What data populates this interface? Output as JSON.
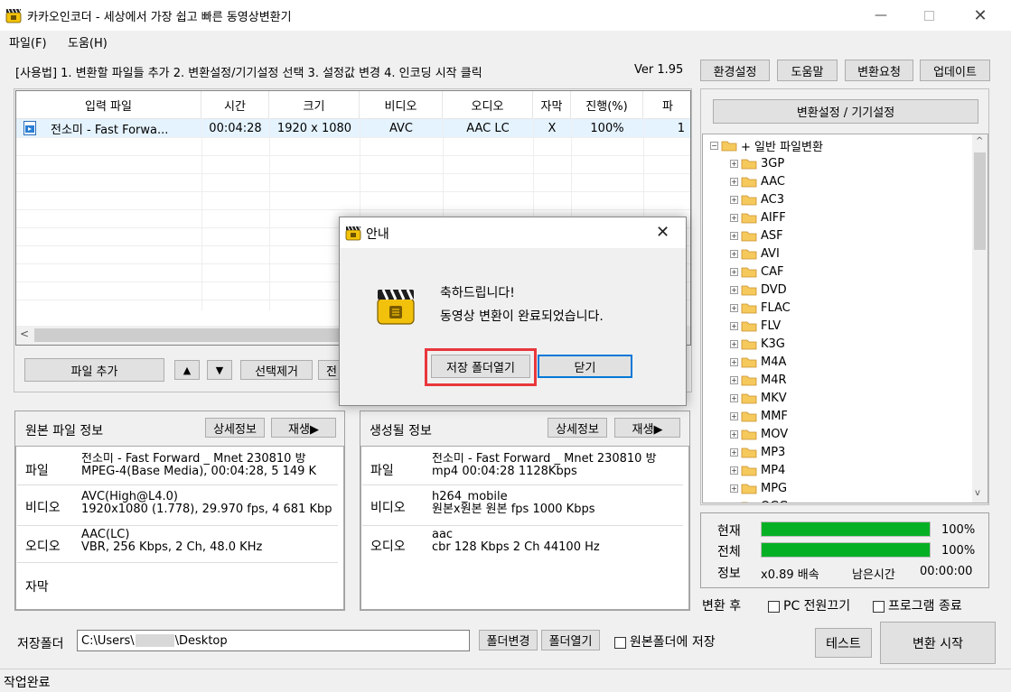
{
  "window": {
    "title": "카카오인코더 - 세상에서 가장 쉽고 빠른 동영상변환기"
  },
  "menu": [
    "파일(F)",
    "도움(H)"
  ],
  "usage_text": "[사용법] 1. 변환할 파일들 추가   2. 변환설정/기기설정 선택   3. 설정값 변경   4. 인코딩 시작 클릭",
  "version": "Ver 1.95",
  "top_buttons": [
    "환경설정",
    "도움말",
    "변환요청",
    "업데이트"
  ],
  "filelist": {
    "columns": [
      "입력 파일",
      "시간",
      "크기",
      "비디오",
      "오디오",
      "자막",
      "진행(%)",
      "파"
    ],
    "rows": [
      {
        "name": "전소미 - Fast Forwa...",
        "time": "00:04:28",
        "size": "1920 x 1080",
        "video": "AVC",
        "audio": "AAC LC",
        "subtitle": "X",
        "progress": "100%",
        "extra": "1"
      }
    ]
  },
  "list_buttons": {
    "add": "파일 추가",
    "up": "▲",
    "down": "▼",
    "remove": "선택제거",
    "clear": "전"
  },
  "source_info": {
    "title": "원본 파일 정보",
    "detail_btn": "상세정보",
    "play_btn": "재생▶",
    "file_label": "파일",
    "file_val1": "전소미 - Fast Forward _ Mnet 230810 방",
    "file_val2": "MPEG-4(Base Media), 00:04:28, 5 149 K",
    "video_label": "비디오",
    "video_val1": "AVC(High@L4.0)",
    "video_val2": "1920x1080 (1.778), 29.970 fps, 4 681 Kbp",
    "audio_label": "오디오",
    "audio_val1": "AAC(LC)",
    "audio_val2": "VBR, 256 Kbps, 2 Ch, 48.0 KHz",
    "sub_label": "자막"
  },
  "output_info": {
    "title": "생성될 정보",
    "detail_btn": "상세정보",
    "play_btn": "재생▶",
    "file_label": "파일",
    "file_val1": "전소미 - Fast Forward _ Mnet 230810 방",
    "file_val2": "mp4  00:04:28  1128Kbps",
    "video_label": "비디오",
    "video_val1": "h264_mobile",
    "video_val2": "원본x원본  원본 fps   1000 Kbps",
    "audio_label": "오디오",
    "audio_val1": "aac",
    "audio_val2": "cbr     128 Kbps   2 Ch   44100 Hz"
  },
  "settings_btn": "변환설정 / 기기설정",
  "tree": {
    "root": "+ 일반 파일변환",
    "items": [
      "3GP",
      "AAC",
      "AC3",
      "AIFF",
      "ASF",
      "AVI",
      "CAF",
      "DVD",
      "FLAC",
      "FLV",
      "K3G",
      "M4A",
      "M4R",
      "MKV",
      "MMF",
      "MOV",
      "MP3",
      "MP4",
      "MPG",
      "OGG"
    ]
  },
  "progress": {
    "current_label": "현재",
    "current_pct": "100%",
    "current_value": 1.0,
    "total_label": "전체",
    "total_pct": "100%",
    "total_value": 1.0,
    "info_label": "정보",
    "speed": "x0.89 배속",
    "remain_label": "남은시간",
    "remain": "00:00:00"
  },
  "after": {
    "label": "변환 후",
    "pc_off": "PC 전원끄기",
    "quit": "프로그램 종료"
  },
  "save": {
    "label": "저장폴더",
    "path_prefix": "C:\\Users\\",
    "path_suffix": "\\Desktop",
    "change_btn": "폴더변경",
    "open_btn": "폴더열기",
    "same_folder": "원본폴더에 저장"
  },
  "test_btn": "테스트",
  "start_btn": "변환 시작",
  "status": "작업완료",
  "dialog": {
    "title": "안내",
    "line1": "축하드립니다!",
    "line2": "동영상 변환이 완료되었습니다.",
    "open_folder_btn": "저장 폴더열기",
    "close_btn": "닫기"
  }
}
